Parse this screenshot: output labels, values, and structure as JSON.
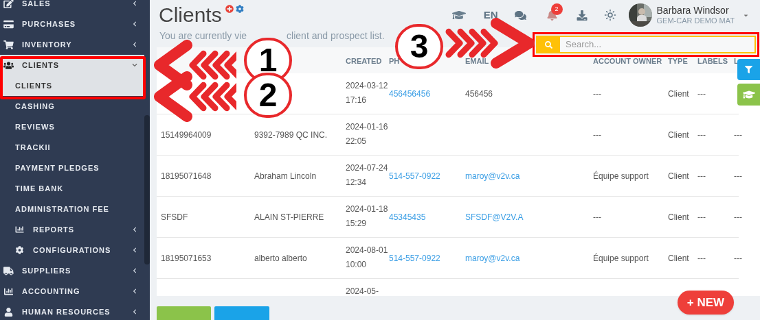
{
  "sidebar": {
    "items": [
      {
        "kind": "group",
        "label": "SALES",
        "expanded": false
      },
      {
        "kind": "group",
        "label": "PURCHASES",
        "expanded": false
      },
      {
        "kind": "group",
        "label": "INVENTORY",
        "expanded": false
      },
      {
        "kind": "group",
        "label": "CLIENTS",
        "expanded": true,
        "children": [
          {
            "kind": "link",
            "label": "CLIENTS",
            "selected": true
          },
          {
            "kind": "link",
            "label": "CASHING",
            "selected": false
          },
          {
            "kind": "link",
            "label": "REVIEWS",
            "selected": false
          },
          {
            "kind": "link",
            "label": "TRACKII",
            "selected": false
          },
          {
            "kind": "link",
            "label": "PAYMENT PLEDGES",
            "selected": false
          },
          {
            "kind": "link",
            "label": "TIME BANK",
            "selected": false
          },
          {
            "kind": "link",
            "label": "ADMINISTRATION FEE",
            "selected": false
          },
          {
            "kind": "group",
            "label": "REPORTS",
            "expanded": false
          },
          {
            "kind": "group",
            "label": "CONFIGURATIONS",
            "expanded": false
          }
        ]
      },
      {
        "kind": "group",
        "label": "SUPPLIERS",
        "expanded": false
      },
      {
        "kind": "group",
        "label": "ACCOUNTING",
        "expanded": false
      },
      {
        "kind": "group",
        "label": "HUMAN RESOURCES",
        "expanded": false
      }
    ]
  },
  "header": {
    "title": "Clients",
    "subtitle_parts": [
      "You are currently vie",
      "client and prospect list."
    ],
    "language": "EN",
    "notifications": "2",
    "user": {
      "name": "Barbara Windsor",
      "company": "GEM-CAR DEMO MAT"
    }
  },
  "search": {
    "placeholder": "Search..."
  },
  "table": {
    "columns": [
      "CREATED",
      "PH",
      "EMAIL",
      "ACCOUNT OWNER",
      "TYPE",
      "LABELS",
      "L"
    ],
    "rows": [
      {
        "created": "2024-03-12 17:16",
        "phone": "456456456",
        "email": "456456",
        "email_link": false,
        "owner": "---",
        "type": "Client",
        "labels": "---"
      },
      {
        "id": "15149964009",
        "name": "9392-7989 QC INC.",
        "created": "2024-01-16 22:05",
        "owner": "---",
        "type": "Client",
        "labels": "---",
        "column_9": "---"
      },
      {
        "id": "18195071648",
        "name": "Abraham Lincoln",
        "created": "2024-07-24 12:34",
        "phone": "514-557-0922",
        "email": "maroy@v2v.ca",
        "email_link": true,
        "owner": "Équipe support",
        "type": "Client",
        "labels": "---",
        "column_9": "---"
      },
      {
        "id": "SFSDF",
        "name": "ALAIN ST-PIERRE",
        "created": "2024-01-18 15:29",
        "phone": "45345435",
        "email": "SFSDF@V2V.A",
        "email_link": true,
        "owner": "---",
        "type": "Client",
        "labels": "---",
        "column_9": "---"
      },
      {
        "id": "18195071653",
        "name": "alberto alberto",
        "created": "2024-08-01 10:00",
        "phone": "514-557-0922",
        "email": "maroy@v2v.ca",
        "email_link": true,
        "owner": "Équipe support",
        "type": "Client",
        "labels": "---",
        "column_9": "---"
      },
      {
        "created": "2024-05-"
      }
    ]
  },
  "new_button": "+ NEW",
  "annotations": [
    {
      "number": "1"
    },
    {
      "number": "2"
    },
    {
      "number": "3"
    }
  ]
}
